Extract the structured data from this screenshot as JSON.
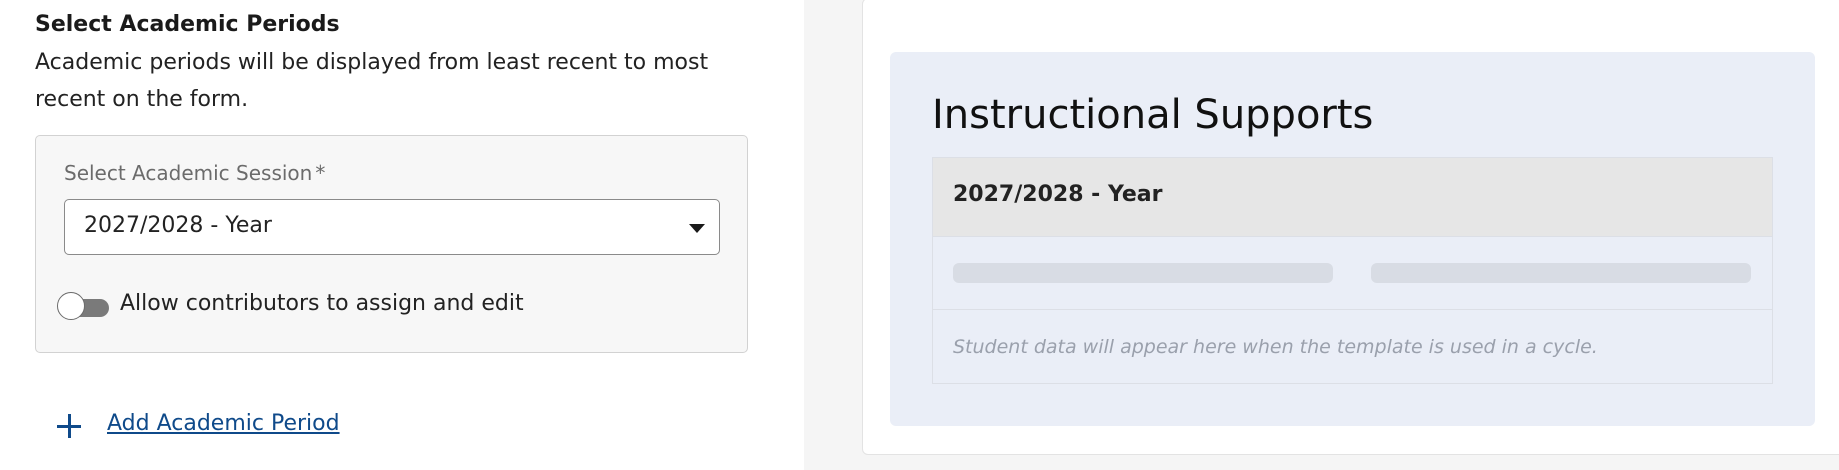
{
  "left": {
    "section_title": "Select Academic Periods",
    "section_description": "Academic periods will be displayed from least recent to most recent on the form.",
    "session_field": {
      "label": "Select Academic Session",
      "required_marker": "*",
      "selected_value": "2027/2028 - Year"
    },
    "toggle": {
      "label": "Allow contributors to assign and edit",
      "state": "off"
    },
    "add_link": {
      "icon": "plus-icon",
      "label": "Add Academic Period"
    }
  },
  "preview": {
    "title": "Instructional Supports",
    "table_header": "2027/2028 - Year",
    "placeholder": "Student data will appear here when the template is used in a cycle."
  },
  "colors": {
    "link": "#0f4a8a",
    "preview_background": "#eaeef7",
    "table_header_background": "#e6e6e6",
    "toggle_off": "#7a7a7a"
  }
}
